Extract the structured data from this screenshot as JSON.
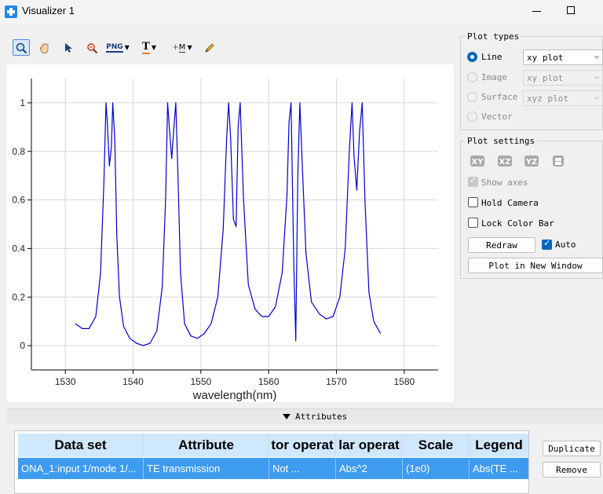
{
  "window": {
    "title": "Visualizer 1"
  },
  "toolbar": {
    "png_label": "PNG",
    "text_label": "T",
    "marker_label": "M"
  },
  "plot_types": {
    "title": "Plot types",
    "options": [
      {
        "label": "Line",
        "value": "xy plot"
      },
      {
        "label": "Image",
        "value": "xy plot"
      },
      {
        "label": "Surface",
        "value": "xyz plot"
      },
      {
        "label": "Vector",
        "value": ""
      }
    ]
  },
  "plot_settings": {
    "title": "Plot settings",
    "views": [
      "XY",
      "XZ",
      "YZ"
    ],
    "show_axes": "Show axes",
    "hold_camera": "Hold Camera",
    "lock_color_bar": "Lock Color Bar",
    "redraw": "Redraw",
    "auto": "Auto",
    "plot_new_window": "Plot in New Window"
  },
  "attributes": {
    "label": "Attributes",
    "columns": [
      "Data set",
      "Attribute",
      "tor operat",
      "lar operat",
      "Scale",
      "Legend"
    ],
    "rows": [
      [
        "ONA_1:input 1/mode 1/...",
        "TE transmission",
        "Not ...",
        "Abs^2",
        "(1e0)",
        "Abs(TE ..."
      ]
    ],
    "duplicate": "Duplicate",
    "remove": "Remove"
  },
  "chart_data": {
    "type": "line",
    "xlabel": "wavelength(nm)",
    "ylabel": "",
    "xlim": [
      1525,
      1585
    ],
    "ylim": [
      -0.1,
      1.1
    ],
    "xticks": [
      1530,
      1540,
      1550,
      1560,
      1570,
      1580
    ],
    "yticks": [
      0,
      0.2,
      0.4,
      0.6,
      0.8,
      1
    ],
    "ytick_labels": [
      "0",
      "0.2",
      "0.4",
      "0.6",
      "0.8",
      "1"
    ],
    "grid": true,
    "color": "#0000cc",
    "series": [
      {
        "x": [
          1531.5,
          1532.5,
          1533.5,
          1534.5,
          1535.2,
          1535.7,
          1536.0,
          1536.2,
          1536.5,
          1536.8,
          1537.0,
          1537.3,
          1537.6,
          1538.0,
          1538.6,
          1539.5,
          1540.5,
          1541.5,
          1542.5,
          1543.5,
          1544.3,
          1544.8,
          1545.1,
          1545.4,
          1545.7,
          1546.0,
          1546.3,
          1546.6,
          1547.0,
          1547.6,
          1548.5,
          1549.5,
          1550.5,
          1551.5,
          1552.5,
          1553.3,
          1553.8,
          1554.1,
          1554.4,
          1554.8,
          1555.2,
          1555.5,
          1555.8,
          1556.3,
          1557.0,
          1558.0,
          1559.0,
          1560.0,
          1561.0,
          1562.0,
          1562.7,
          1563.0,
          1563.3,
          1563.7,
          1564.0,
          1564.3,
          1564.6,
          1565.0,
          1565.5,
          1566.3,
          1567.5,
          1568.5,
          1569.5,
          1570.5,
          1571.3,
          1571.9,
          1572.3,
          1572.6,
          1573.0,
          1573.4,
          1573.8,
          1574.2,
          1574.8,
          1575.5,
          1576.5
        ],
        "y": [
          0.09,
          0.07,
          0.07,
          0.12,
          0.3,
          0.68,
          1.0,
          0.92,
          0.74,
          0.82,
          1.0,
          0.85,
          0.45,
          0.2,
          0.08,
          0.03,
          0.01,
          0.0,
          0.01,
          0.06,
          0.24,
          0.6,
          1.0,
          0.88,
          0.77,
          0.89,
          1.0,
          0.72,
          0.3,
          0.09,
          0.04,
          0.03,
          0.05,
          0.09,
          0.2,
          0.48,
          0.85,
          1.0,
          0.85,
          0.52,
          0.49,
          0.9,
          1.0,
          0.6,
          0.25,
          0.15,
          0.12,
          0.12,
          0.16,
          0.3,
          0.62,
          0.92,
          1.0,
          0.35,
          0.02,
          0.7,
          1.0,
          0.72,
          0.38,
          0.18,
          0.13,
          0.11,
          0.12,
          0.2,
          0.4,
          0.8,
          1.0,
          0.78,
          0.64,
          0.88,
          1.0,
          0.6,
          0.22,
          0.1,
          0.05
        ]
      }
    ]
  }
}
